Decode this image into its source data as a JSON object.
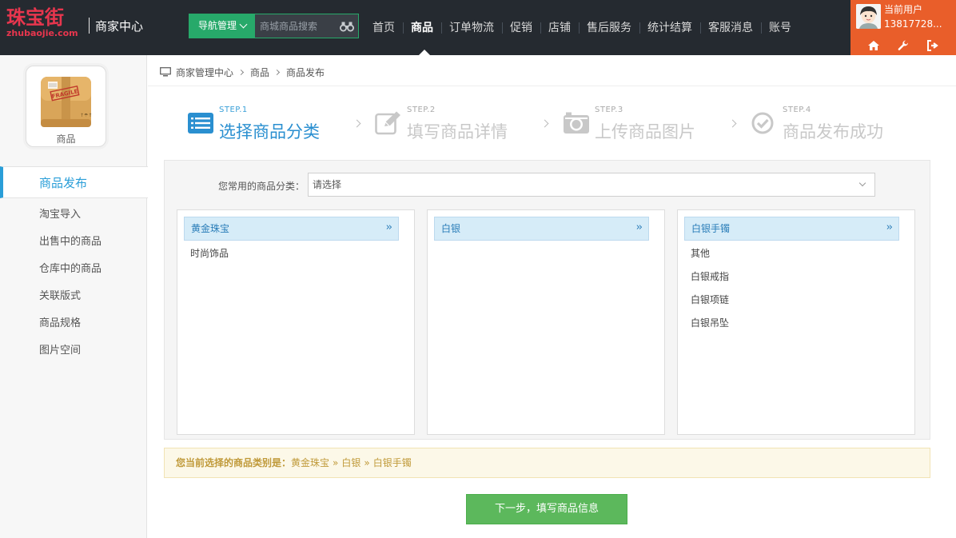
{
  "logo": {
    "cn": "珠宝街",
    "en": "zhubaojie.com"
  },
  "header": {
    "center_title": "商家中心",
    "nav_manage_label": "导航管理",
    "search_placeholder": "商城商品搜索",
    "nav_items": [
      "首页",
      "商品",
      "订单物流",
      "促销",
      "店铺",
      "售后服务",
      "统计结算",
      "客服消息",
      "账号"
    ],
    "active_nav": "商品",
    "user": {
      "label": "当前用户",
      "phone": "13817728..."
    },
    "user_icons": [
      "home-icon",
      "wrench-icon",
      "logout-icon"
    ]
  },
  "sidebar": {
    "module_label": "商品",
    "items": [
      "商品发布",
      "淘宝导入",
      "出售中的商品",
      "仓库中的商品",
      "关联版式",
      "商品规格",
      "图片空间"
    ],
    "active": "商品发布"
  },
  "breadcrumb": [
    "商家管理中心",
    "商品",
    "商品发布"
  ],
  "steps": [
    {
      "num": "STEP.1",
      "title": "选择商品分类",
      "icon": "list-icon",
      "active": true
    },
    {
      "num": "STEP.2",
      "title": "填写商品详情",
      "icon": "edit-icon",
      "active": false
    },
    {
      "num": "STEP.3",
      "title": "上传商品图片",
      "icon": "camera-icon",
      "active": false
    },
    {
      "num": "STEP.4",
      "title": "商品发布成功",
      "icon": "check-circle-icon",
      "active": false
    }
  ],
  "favorite": {
    "label": "您常用的商品分类：",
    "value": "请选择"
  },
  "category_columns": [
    {
      "selected": "黄金珠宝",
      "items": [
        "时尚饰品"
      ]
    },
    {
      "selected": "白银",
      "items": []
    },
    {
      "selected": "白银手镯",
      "items": [
        "其他",
        "白银戒指",
        "白银项链",
        "白银吊坠"
      ]
    }
  ],
  "current": {
    "label": "您当前选择的商品类别是：",
    "path": [
      "黄金珠宝",
      "白银",
      "白银手镯"
    ],
    "sep": "»"
  },
  "next_button": "下一步，填写商品信息",
  "colors": {
    "topbar_bg": "#252a30",
    "accent_green": "#27a96a",
    "user_orange": "#e95e2a",
    "active_blue": "#2a9ed8",
    "button_green": "#5cb85c",
    "brand_red": "#e8364e"
  }
}
